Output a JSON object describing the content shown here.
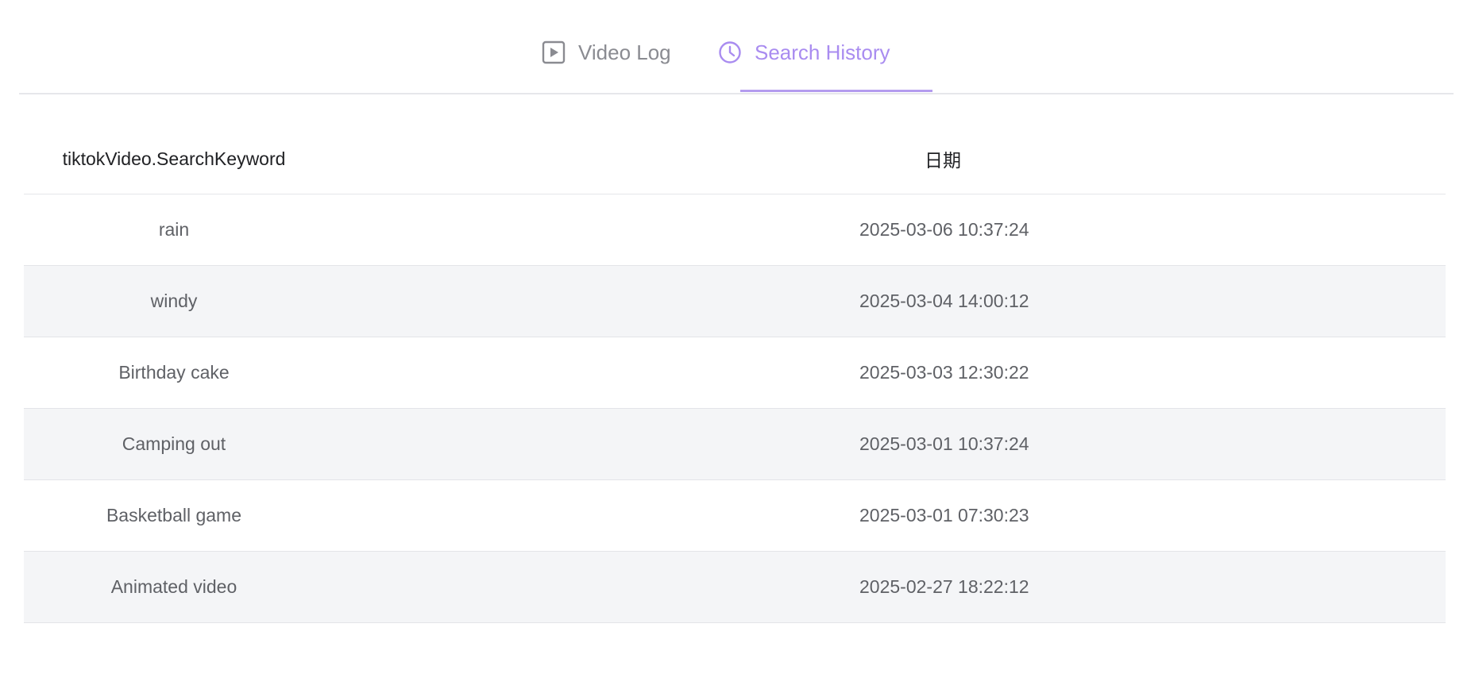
{
  "tabs": [
    {
      "label": "Video Log",
      "icon": "play-square-icon",
      "active": false
    },
    {
      "label": "Search History",
      "icon": "clock-icon",
      "active": true
    }
  ],
  "colors": {
    "accent": "#a98cf0",
    "tab_inactive": "#8a8b91",
    "row_alt": "#f4f5f7"
  },
  "table": {
    "headers": {
      "keyword": "tiktokVideo.SearchKeyword",
      "date": "日期"
    },
    "rows": [
      {
        "keyword": "rain",
        "date": "2025-03-06 10:37:24"
      },
      {
        "keyword": "windy",
        "date": "2025-03-04 14:00:12"
      },
      {
        "keyword": "Birthday cake",
        "date": "2025-03-03 12:30:22"
      },
      {
        "keyword": "Camping out",
        "date": "2025-03-01 10:37:24"
      },
      {
        "keyword": "Basketball game",
        "date": "2025-03-01 07:30:23"
      },
      {
        "keyword": "Animated video",
        "date": "2025-02-27 18:22:12"
      }
    ]
  }
}
